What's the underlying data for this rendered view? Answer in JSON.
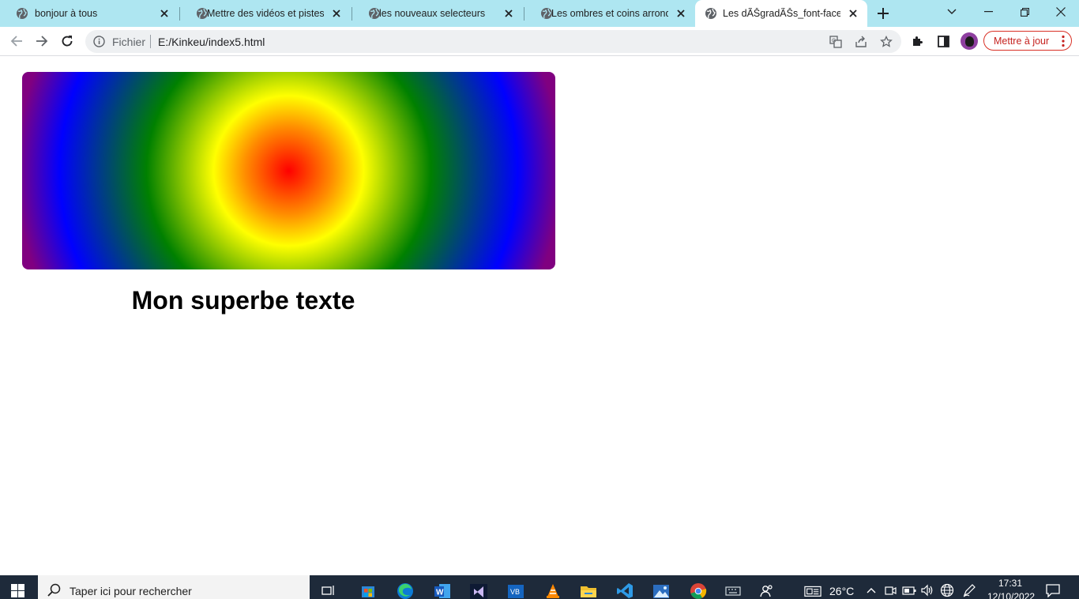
{
  "tabs": [
    {
      "title": "bonjour à tous"
    },
    {
      "title": "Mettre des vidéos et pistes audio"
    },
    {
      "title": "les nouveaux selecteurs"
    },
    {
      "title": "Les ombres et coins arrondis"
    },
    {
      "title": "Les dÃŠgradÃŠs_font-face"
    }
  ],
  "omnibox": {
    "scheme_label": "Fichier",
    "url": "E:/Kinkeu/index5.html"
  },
  "toolbar": {
    "update_button": "Mettre à jour"
  },
  "page": {
    "headline": "Mon superbe texte",
    "gradient_colors": [
      "#ff0000",
      "#ff8c00",
      "#ffff00",
      "#008000",
      "#0000ff",
      "#800080"
    ]
  },
  "taskbar": {
    "search_placeholder": "Taper ici pour rechercher",
    "temperature": "26°C",
    "time": "17:31",
    "date": "12/10/2022"
  },
  "colors": {
    "tabstrip_bg": "#aee6f1",
    "taskbar_bg": "#1e2a3a",
    "update_accent": "#d93025"
  }
}
